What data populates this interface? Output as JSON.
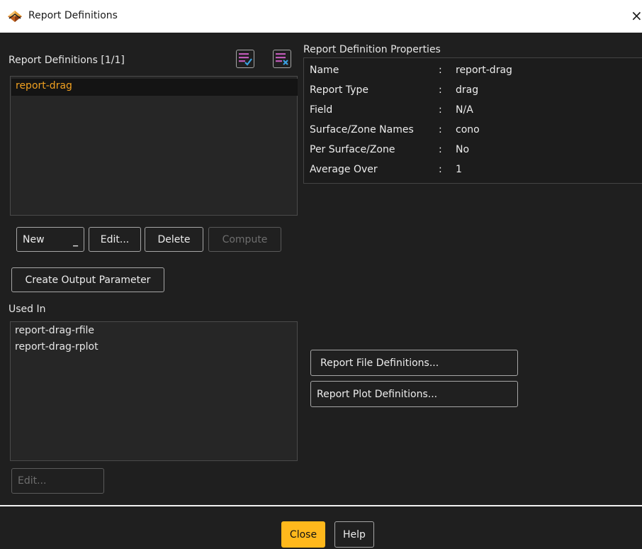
{
  "window": {
    "title": "Report Definitions",
    "close_glyph": "×"
  },
  "definitions": {
    "header": "Report Definitions [1/1]",
    "items": [
      {
        "label": "report-drag",
        "selected": true
      }
    ],
    "check_icon": "list-check-icon",
    "clear_icon": "list-clear-icon"
  },
  "actions": {
    "new_label": "New",
    "edit_label": "Edit...",
    "delete_label": "Delete",
    "compute_label": "Compute",
    "create_param_label": "Create Output Parameter"
  },
  "used_in": {
    "header": "Used In",
    "items": [
      "report-drag-rfile",
      "report-drag-rplot"
    ],
    "edit_label": "Edit..."
  },
  "properties": {
    "header": "Report Definition Properties",
    "rows": [
      {
        "key": "Name",
        "value": "report-drag"
      },
      {
        "key": "Report Type",
        "value": "drag"
      },
      {
        "key": "Field",
        "value": "N/A"
      },
      {
        "key": "Surface/Zone Names",
        "value": "cono"
      },
      {
        "key": "Per Surface/Zone",
        "value": "No"
      },
      {
        "key": "Average Over",
        "value": "1"
      }
    ],
    "separator": ":"
  },
  "links": {
    "file_defs_label": "Report File Definitions...",
    "plot_defs_label": "Report Plot Definitions..."
  },
  "footer": {
    "close_label": "Close",
    "help_label": "Help"
  },
  "colors": {
    "accent": "#ffb81c",
    "selected_text": "#f0a020",
    "background": "#1f1f1f",
    "icon_check": "#c05ab8",
    "icon_check_mark": "#3aa0e0"
  }
}
